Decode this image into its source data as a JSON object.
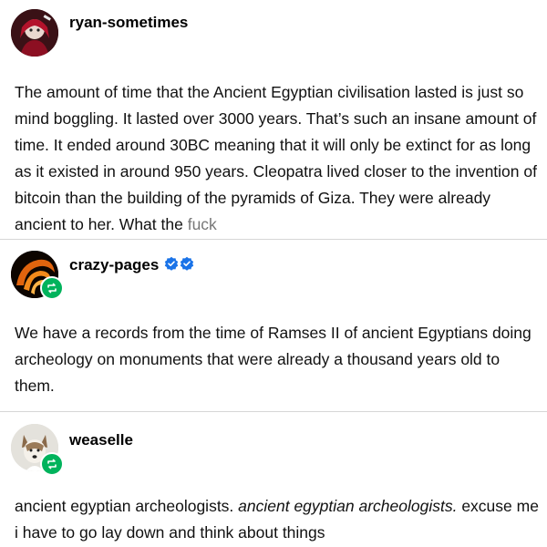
{
  "posts": [
    {
      "username": "ryan-sometimes",
      "avatar_icon": "avatar-red-character",
      "text_main": "The amount of time that the Ancient Egyptian civilisation lasted is just so mind boggling. It lasted over 3000 years. That’s such an insane amount of time. It ended around 30BC meaning that it will only be extinct for as long as it existed in around 950 years. Cleopatra lived closer to the invention of bitcoin than the building of the pyramids of Giza. They were already ancient to her. What the ",
      "text_censored": "fuck"
    },
    {
      "username": "crazy-pages",
      "avatar_icon": "avatar-orange-swirl",
      "verified_icons": [
        "verified-badge-icon",
        "verified-badge-icon"
      ],
      "reblog_icon": "reblog-icon",
      "text": "We have a records from the time of Ramses II of ancient Egyptians doing archeology on monuments that were already a thousand years old to them."
    },
    {
      "username": "weaselle",
      "avatar_icon": "avatar-dog",
      "reblog_icon": "reblog-icon",
      "text_plain": "ancient egyptian archeologists. ",
      "text_italic": "ancient egyptian archeologists.",
      "text_end": " excuse me i have to go lay down and think about things"
    }
  ],
  "colors": {
    "reblog_green": "#00b35c",
    "verified_blue": "#1a73e8",
    "divider": "#d6d6d6"
  }
}
